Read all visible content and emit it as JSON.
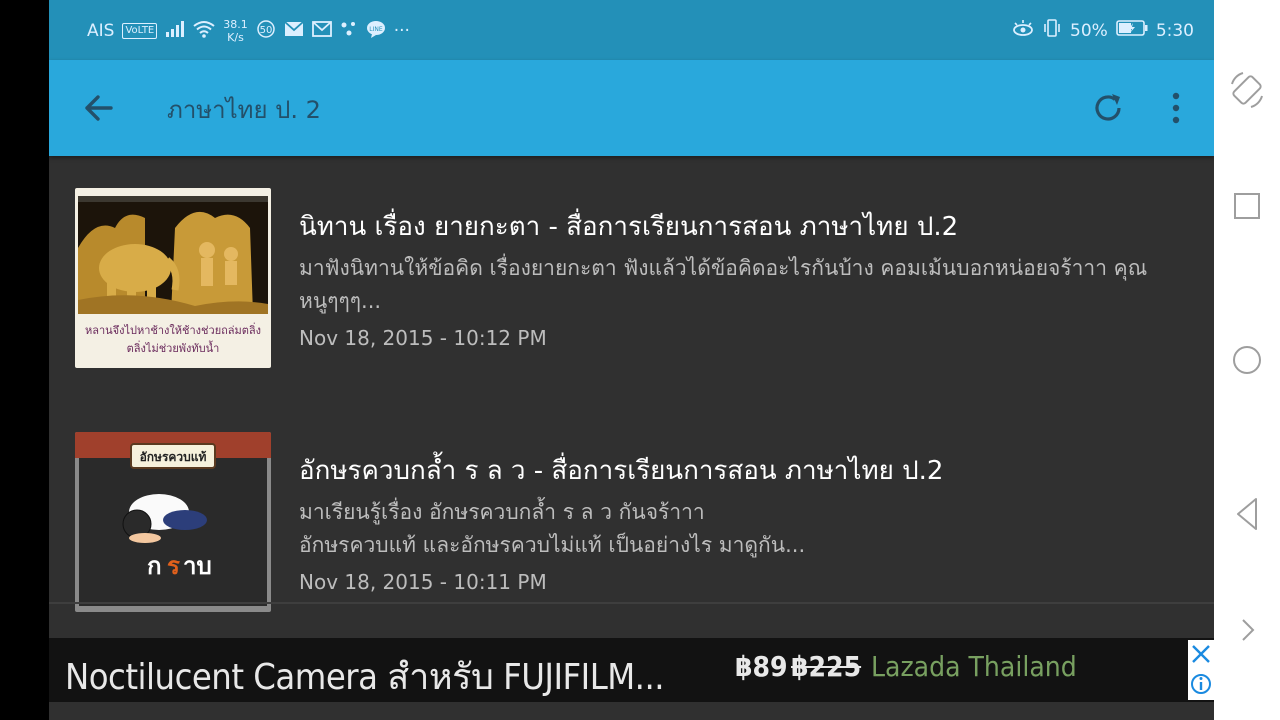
{
  "status_bar": {
    "carrier": "AIS",
    "volte": "VoLTE",
    "speed_value": "38.1",
    "speed_unit": "K/s",
    "badge": "50",
    "more": "···",
    "battery": "50%",
    "time": "5:30"
  },
  "app_bar": {
    "title": "ภาษาไทย ป. 2",
    "icons": [
      "back-arrow-icon",
      "refresh-icon",
      "more-vert-icon"
    ],
    "background_color": "#29a8dc"
  },
  "items": [
    {
      "title": "นิทาน เรื่อง ยายกะตา - สื่อการเรียนการสอน ภาษาไทย ป.2",
      "desc_line1": "มาฟังนิทานให้ข้อคิด เรื่องยายกะตา ฟังแล้วได้ข้อคิดอะไรกันบ้าง คอมเม้นบอกหน่อยจร้าาา คุณ",
      "desc_line2": "หนูๆๆๆ...",
      "date": "Nov 18, 2015 - 10:12 PM",
      "thumb_caption_1": "หลานจึงไปหาช้างให้ช้างช่วยถล่มตลิ่ง",
      "thumb_caption_2": "ตลิ่งไม่ช่วยพังทับน้ำ"
    },
    {
      "title": "อักษรควบกล้ำ ร ล ว - สื่อการเรียนการสอน ภาษาไทย ป.2",
      "desc_line1": "มาเรียนรู้เรื่อง อักษรควบกล้ำ ร ล ว กันจร้าาา",
      "desc_line2": "อักษรควบแท้ และอักษรควบไม่แท้ เป็นอย่างไร มาดูกัน...",
      "date": "Nov 18, 2015 - 10:11 PM",
      "thumb_label": "อักษรควบแท้",
      "thumb_word_1": "ก",
      "thumb_word_2": "ร",
      "thumb_word_3": "าบ"
    }
  ],
  "ad": {
    "text": "Noctilucent Camera สำหรับ FUJIFILM...",
    "price": "฿89",
    "old_price": "฿225",
    "shop": "Lazada Thailand"
  },
  "nav_bar": {
    "icons": [
      "rotate-icon",
      "square-icon",
      "circle-icon",
      "triangle-back-icon",
      "chevron-right-icon"
    ]
  }
}
